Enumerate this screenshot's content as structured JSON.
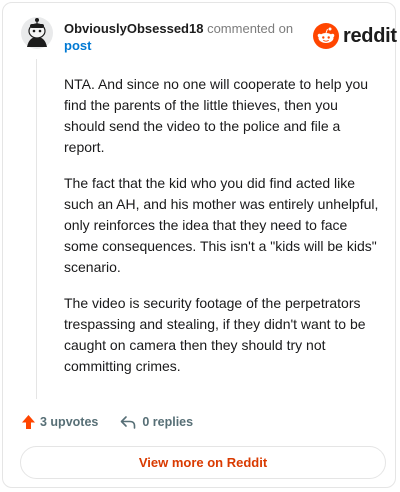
{
  "comment": {
    "username": "ObviouslyObsessed18",
    "action_text": "commented on",
    "post_link": "post",
    "paragraphs": [
      "NTA. And since no one will cooperate to help you find the parents of the little thieves, then you should send the video to the police and file a report.",
      "The fact that the kid who you did find acted like such an AH, and his mother was entirely unhelpful, only reinforces the idea that they need to face some consequences. This isn't a \"kids will be kids\" scenario.",
      "The video is security footage of the perpetrators trespassing and stealing, if they didn't want to be caught on camera then they should try not committing crimes."
    ]
  },
  "brand": {
    "name": "reddit",
    "icon": "reddit-logo-icon",
    "color": "#ff4500"
  },
  "actions": {
    "upvotes_label": "3 upvotes",
    "replies_label": "0 replies",
    "upvote_icon": "upvote-arrow-icon",
    "reply_icon": "reply-arrow-icon",
    "upvote_color": "#ff4500"
  },
  "footer": {
    "view_more_label": "View more on Reddit"
  },
  "colors": {
    "link": "#0079d3",
    "accent": "#d93a00"
  }
}
